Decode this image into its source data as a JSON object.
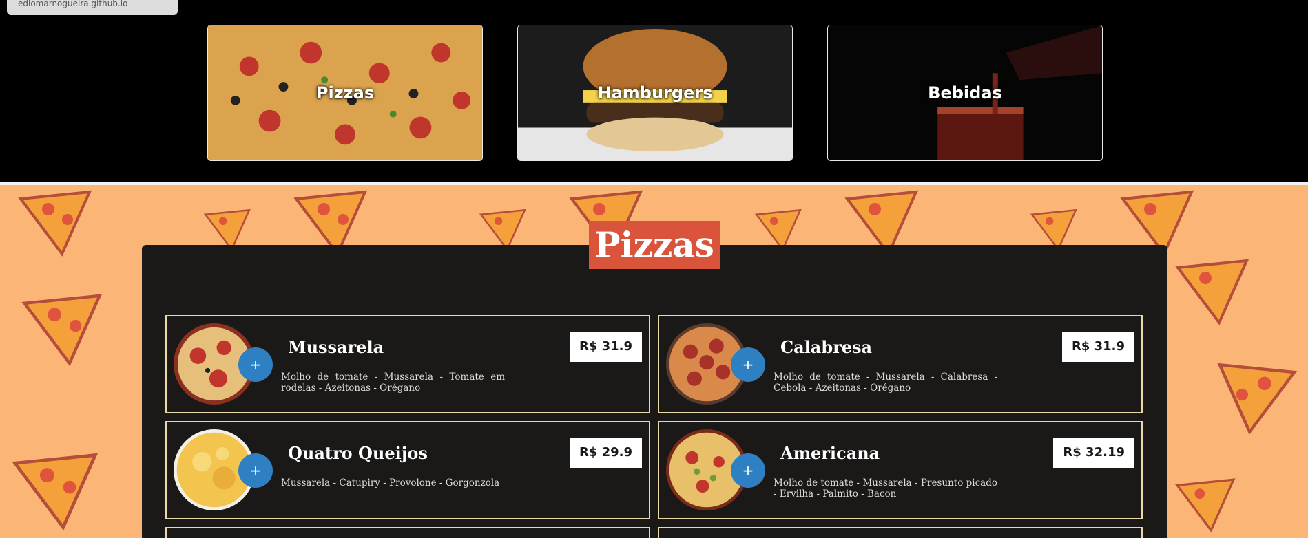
{
  "browser": {
    "url_tooltip": "ediomarnogueira.github.io"
  },
  "categories": [
    {
      "label": "Pizzas"
    },
    {
      "label": "Hamburgers"
    },
    {
      "label": "Bebidas"
    }
  ],
  "section": {
    "title": "Pizzas"
  },
  "items": [
    {
      "name": "Mussarela",
      "price": "R$ 31.9",
      "description": "Molho de tomate - Mussarela - Tomate em rodelas - Azeitonas - Orégano",
      "add_label": "+"
    },
    {
      "name": "Calabresa",
      "price": "R$ 31.9",
      "description": "Molho de tomate - Mussarela - Calabresa - Cebola - Azeitonas - Orégano",
      "add_label": "+"
    },
    {
      "name": "Quatro Queijos",
      "price": "R$ 29.9",
      "description": "Mussarela - Catupiry - Provolone - Gorgonzola",
      "add_label": "+"
    },
    {
      "name": "Americana",
      "price": "R$ 32.19",
      "description": "Molho de tomate - Mussarela - Presunto picado - Ervilha - Palmito - Bacon",
      "add_label": "+"
    }
  ],
  "colors": {
    "accent_title": "#d9543a",
    "add_button": "#2f80c2",
    "pattern_bg": "#fbb677",
    "card_border": "#e8d9a6"
  },
  "icons": {
    "add": "plus-icon",
    "pattern": "pizza-slice-icon"
  }
}
